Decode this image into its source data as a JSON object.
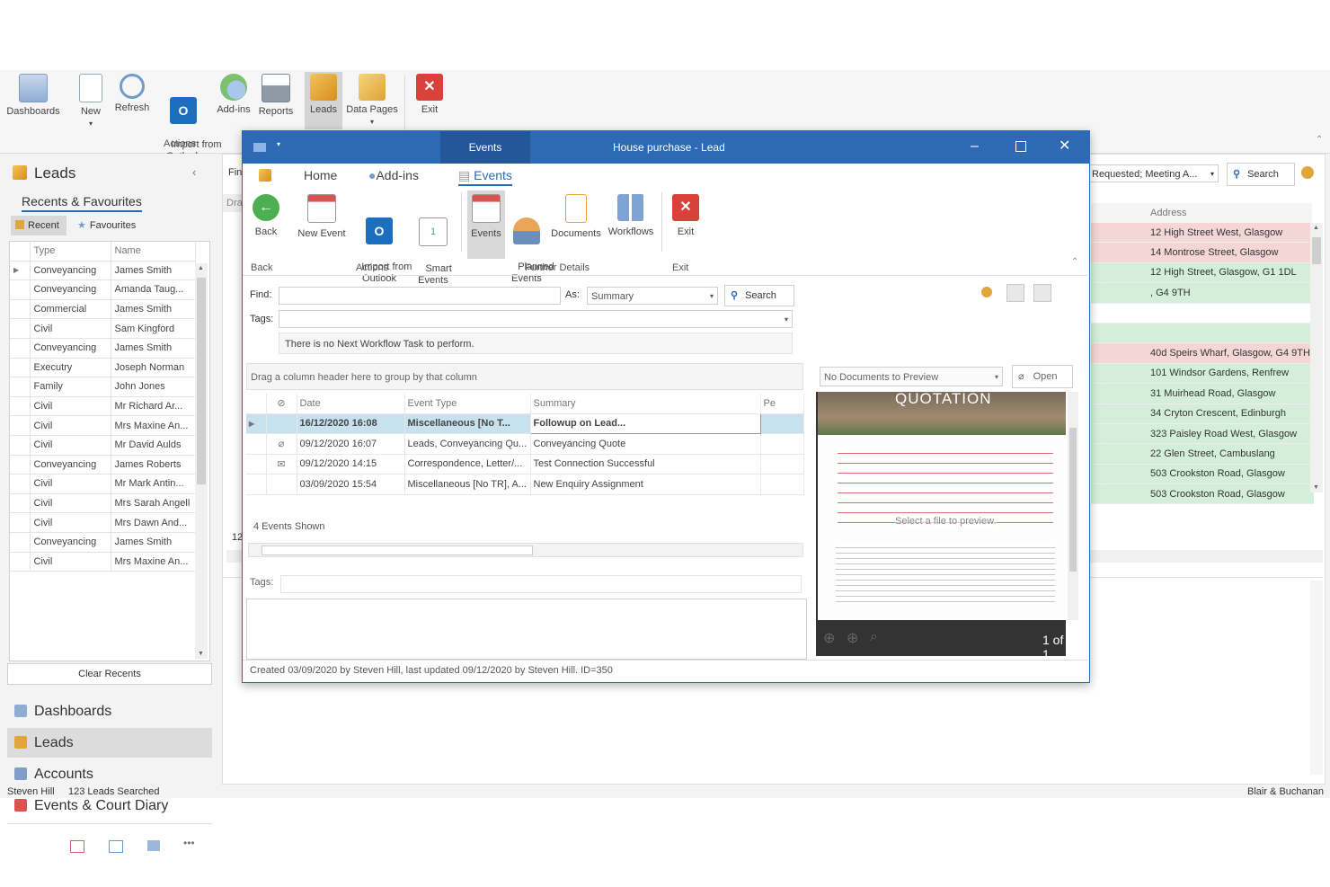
{
  "ribbon": {
    "buttons": [
      {
        "label": "Dashboards"
      },
      {
        "label": "New"
      },
      {
        "label": "Refresh"
      },
      {
        "label": "Import from\nOutlook"
      },
      {
        "label": "Add-ins"
      },
      {
        "label": "Reports"
      },
      {
        "label": "Leads"
      },
      {
        "label": "Data Pages"
      },
      {
        "label": "Exit"
      }
    ],
    "group_actions": "Actions"
  },
  "leftnav": {
    "title": "Leads",
    "recents_title": "Recents & Favourites",
    "tab_recent": "Recent",
    "tab_favourites": "Favourites",
    "col_type": "Type",
    "col_name": "Name",
    "rows": [
      {
        "type": "Conveyancing",
        "name": "James Smith"
      },
      {
        "type": "Conveyancing",
        "name": "Amanda Taug..."
      },
      {
        "type": "Commercial",
        "name": "James Smith"
      },
      {
        "type": "Civil",
        "name": "Sam Kingford"
      },
      {
        "type": "Conveyancing",
        "name": "James Smith"
      },
      {
        "type": "Executry",
        "name": "Joseph Norman"
      },
      {
        "type": "Family",
        "name": "John Jones"
      },
      {
        "type": "Civil",
        "name": "Mr Richard Ar..."
      },
      {
        "type": "Civil",
        "name": "Mrs Maxine An..."
      },
      {
        "type": "Civil",
        "name": "Mr David Aulds"
      },
      {
        "type": "Conveyancing",
        "name": "James Roberts"
      },
      {
        "type": "Civil",
        "name": "Mr Mark Antin..."
      },
      {
        "type": "Civil",
        "name": "Mrs Sarah Angell"
      },
      {
        "type": "Civil",
        "name": "Mrs Dawn And..."
      },
      {
        "type": "Conveyancing",
        "name": "James Smith"
      },
      {
        "type": "Civil",
        "name": "Mrs Maxine An..."
      }
    ],
    "clear_recents": "Clear Recents",
    "nav_items": [
      "Dashboards",
      "Leads",
      "Accounts",
      "Events & Court Diary"
    ],
    "more": "•••"
  },
  "content": {
    "filter_value": "Requested; Meeting A...",
    "search_label": "Search",
    "address_header": "Address",
    "addresses": [
      {
        "text": "12 High Street West,  Glasgow",
        "color": "#f4d6d6"
      },
      {
        "text": "14 Montrose Street,  Glasgow",
        "color": "#f4d6d6"
      },
      {
        "text": "12 High Street, Glasgow, G1 1DL",
        "color": "#d3efd9"
      },
      {
        "text": ", G4 9TH",
        "color": "#d3efd9"
      },
      {
        "text": "",
        "color": "#ffffff"
      },
      {
        "text": "",
        "color": "#d3efd9"
      },
      {
        "text": "40d Speirs Wharf, Glasgow, G4 9TH",
        "color": "#f4d6d6"
      },
      {
        "text": "101 Windsor Gardens,  Renfrew",
        "color": "#d3efd9"
      },
      {
        "text": "31 Muirhead Road,  Glasgow",
        "color": "#d3efd9"
      },
      {
        "text": "34 Cryton Crescent,  Edinburgh",
        "color": "#d3efd9"
      },
      {
        "text": "323 Paisley Road West,  Glasgow",
        "color": "#d3efd9"
      },
      {
        "text": "22 Glen Street,  Cambuslang",
        "color": "#d3efd9"
      },
      {
        "text": "503 Crookston Road,  Glasgow",
        "color": "#d3efd9"
      },
      {
        "text": "503 Crookston Road,  Glasgow",
        "color": "#d3efd9"
      }
    ],
    "fin_label": "Fin",
    "dra_label": "Dra",
    "num_label": "12"
  },
  "dialog": {
    "context_tab": "Events",
    "title": "House purchase - Lead",
    "tabs": [
      "Home",
      "Add-ins",
      "Events"
    ],
    "buttons": [
      {
        "label": "Back"
      },
      {
        "label": "New Event"
      },
      {
        "label": "Import from\nOutlook"
      },
      {
        "label": "Smart\nEvents"
      },
      {
        "label": "Events"
      },
      {
        "label": "Planned\nEvents"
      },
      {
        "label": "Documents"
      },
      {
        "label": "Workflows"
      },
      {
        "label": "Exit"
      }
    ],
    "groups": {
      "back": "Back",
      "actions": "Actions",
      "further": "Further Details",
      "exit": "Exit"
    },
    "find_label": "Find:",
    "as_label": "As:",
    "as_value": "Summary",
    "search_label": "Search",
    "tags_label": "Tags:",
    "no_task": "There is no Next Workflow Task to perform.",
    "group_hint": "Drag a column header here to group by that column",
    "columns": [
      "Date",
      "Event Type",
      "Summary",
      "Pe"
    ],
    "events": [
      {
        "date": "16/12/2020 16:08",
        "type": "Miscellaneous [No T...",
        "summary": "Followup on Lead...",
        "icon": ""
      },
      {
        "date": "09/12/2020 16:07",
        "type": "Leads, Conveyancing Qu...",
        "summary": "Conveyancing Quote",
        "icon": "clip"
      },
      {
        "date": "09/12/2020 14:15",
        "type": "Correspondence, Letter/...",
        "summary": "Test Connection Successful",
        "icon": "mail"
      },
      {
        "date": "03/09/2020 15:54",
        "type": "Miscellaneous [No TR], A...",
        "summary": "New Enquiry Assignment",
        "icon": ""
      }
    ],
    "events_shown": "4 Events Shown",
    "tags2_label": "Tags:",
    "doc_select": "No Documents to Preview",
    "open_label": "Open",
    "quotation": "QUOTATION",
    "select_file": "Select a file to preview.",
    "page_count": "1 of 1",
    "footer": "Created 03/09/2020 by Steven Hill, last updated 09/12/2020 by Steven Hill. ID=350"
  },
  "status": {
    "user": "Steven Hill",
    "leads": "123 Leads Searched",
    "firm": "Blair & Buchanan"
  }
}
